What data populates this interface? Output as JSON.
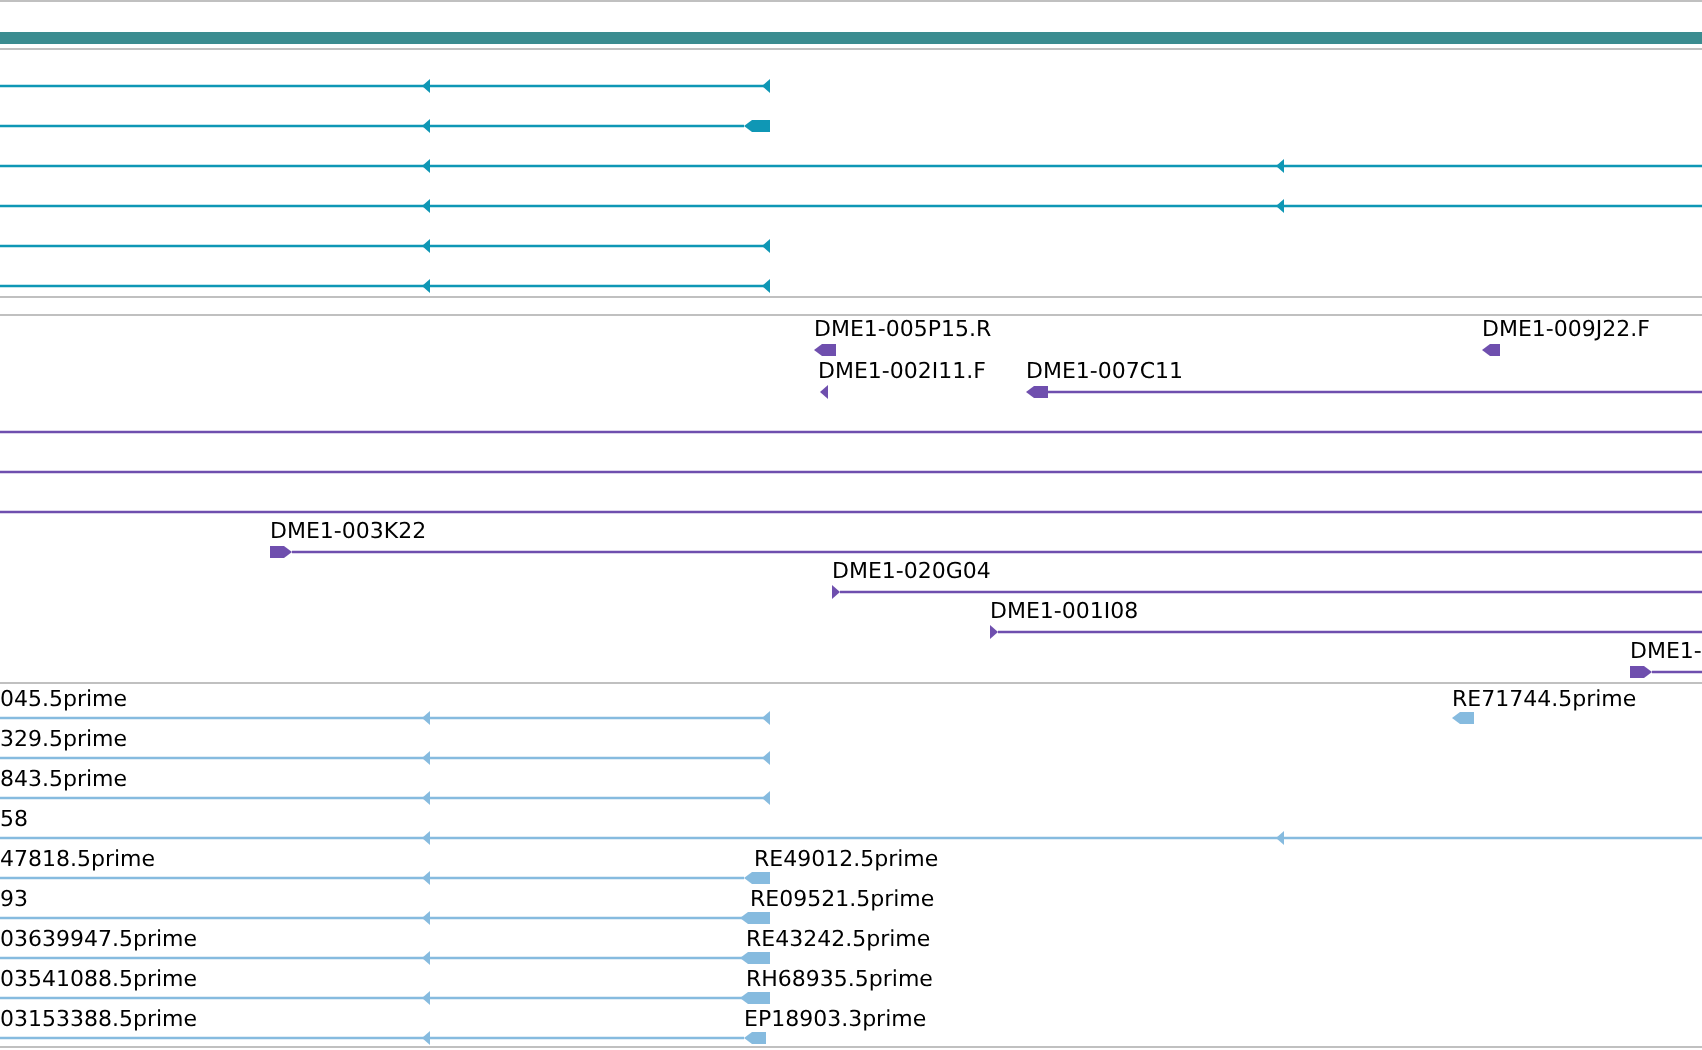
{
  "tracks": [
    {
      "features": [
        {
          "kind": "arrow",
          "reverse": true
        },
        {
          "kind": "arrow",
          "reverse": true
        },
        {
          "kind": "arrow",
          "reverse": true
        },
        {
          "kind": "arrow",
          "reverse": true
        },
        {
          "kind": "arrow",
          "reverse": true
        },
        {
          "kind": "arrow",
          "reverse": true
        }
      ]
    },
    {
      "features": [
        {
          "kind": "arrow",
          "label": "DME1-005P15.R",
          "reverse": true
        },
        {
          "kind": "arrow",
          "label": "DME1-009J22.F",
          "reverse": true
        },
        {
          "kind": "arrow",
          "label": "DME1-002I11.F",
          "reverse": true
        },
        {
          "kind": "arrow",
          "label": "DME1-007C11",
          "reverse": true
        },
        {
          "kind": "span"
        },
        {
          "kind": "span"
        },
        {
          "kind": "span"
        },
        {
          "kind": "arrow",
          "label": "DME1-003K22",
          "reverse": false
        },
        {
          "kind": "arrow",
          "label": "DME1-020G04",
          "reverse": false
        },
        {
          "kind": "arrow",
          "label": "DME1-001I08",
          "reverse": false
        },
        {
          "kind": "arrow",
          "label": "DME1-",
          "reverse": false
        }
      ]
    },
    {
      "features": [
        {
          "kind": "arrow",
          "label": "045.5prime",
          "reverse": true
        },
        {
          "kind": "arrow",
          "label": "RE71744.5prime",
          "reverse": true
        },
        {
          "kind": "arrow",
          "label": "329.5prime",
          "reverse": true
        },
        {
          "kind": "arrow",
          "label": "843.5prime",
          "reverse": true
        },
        {
          "kind": "arrow",
          "label": "58",
          "reverse": true
        },
        {
          "kind": "arrow",
          "label": "47818.5prime",
          "reverse": true
        },
        {
          "kind": "arrow",
          "label": "RE49012.5prime",
          "reverse": true
        },
        {
          "kind": "arrow",
          "label": "93",
          "reverse": true
        },
        {
          "kind": "arrow",
          "label": "RE09521.5prime",
          "reverse": true
        },
        {
          "kind": "arrow",
          "label": "03639947.5prime",
          "reverse": true
        },
        {
          "kind": "arrow",
          "label": "RE43242.5prime",
          "reverse": true
        },
        {
          "kind": "arrow",
          "label": "03541088.5prime",
          "reverse": true
        },
        {
          "kind": "arrow",
          "label": "RH68935.5prime",
          "reverse": true
        },
        {
          "kind": "arrow",
          "label": "03153388.5prime",
          "reverse": true
        },
        {
          "kind": "arrow",
          "label": "EP18903.3prime",
          "reverse": true
        }
      ]
    }
  ]
}
